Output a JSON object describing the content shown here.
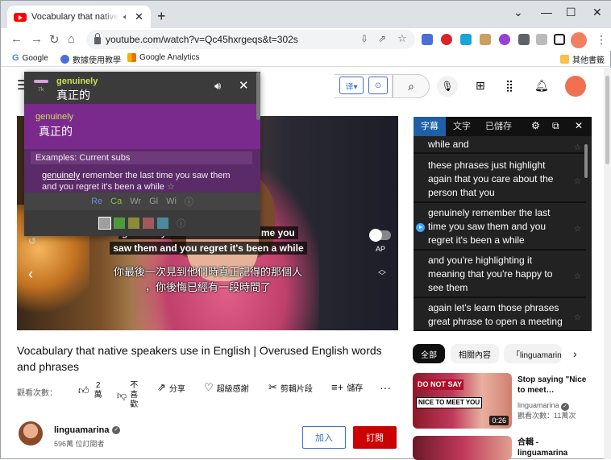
{
  "browser": {
    "tab_title": "Vocabulary that native speakers use in English",
    "url": "youtube.com/watch?v=Qc45hxrgeqs&t=302s",
    "bookmarks": [
      "Google",
      "數據使用教學",
      "Google Analytics"
    ],
    "other_bookmarks": "其他書籤"
  },
  "dictionary": {
    "frequency": "7k",
    "word": "genuinely",
    "translation": "真正的",
    "entry_word": "genuinely",
    "entry_translation": "真正的",
    "examples_header": "Examples: Current subs",
    "example_highlight": "genuinely",
    "example_rest": " remember the last time you saw them and you regret it's been a while",
    "sources": [
      "Re",
      "Ca",
      "Wr",
      "Gl",
      "Wi"
    ],
    "info_icon": "ⓘ",
    "swatches": [
      "#9e9e9e",
      "#4e9a3a",
      "#8a8a3a",
      "#a05a5a",
      "#4a8a9a"
    ]
  },
  "video": {
    "caption_en_1": "gen ..nely remember the last time you",
    "caption_en_2": "saw them and you regret it's been a while",
    "caption_zh_1": "你最後一次見到他們時真正記得的那個人",
    "caption_zh_2": "，你後悔已經有一段時間了",
    "ap_label": "AP"
  },
  "subtitle_panel": {
    "tabs": [
      "字幕",
      "文字",
      "已儲存"
    ],
    "items": [
      "while and",
      "these phrases just highlight again that you care about the person that you",
      "genuinely remember the last time you saw them and you regret it's been a while",
      "and you're highlighting it meaning that you're happy to see them",
      "again let's learn those phrases great phrase to open a meeting with"
    ]
  },
  "video_info": {
    "title": "Vocabulary that native speakers use in English | Overused English words and phrases",
    "views_label": "觀看次數：",
    "likes": "2萬",
    "dislike": "不喜歡",
    "share": "分享",
    "thanks": "超級感謝",
    "clip": "剪輯片段",
    "save": "儲存",
    "more": "···",
    "channel": "linguamarina",
    "subscribers": "596萬 位訂閱者",
    "join": "加入",
    "subscribe": "訂閱"
  },
  "chips": [
    "全部",
    "相關內容",
    "「linguamarina"
  ],
  "recommendations": [
    {
      "title": "Stop saying \"Nice to meet…",
      "channel": "linguamarina",
      "views": "觀看次數：11萬次",
      "duration": "0:26",
      "thumb_text_1": "DO NOT SAY",
      "thumb_text_2": "NICE TO MEET YOU"
    },
    {
      "title": "合輯 - linguamarina"
    }
  ],
  "colors": {
    "dict_purple": "#7a2a8c",
    "subtitle_active_tab": "#1e5fa8",
    "subscribe_red": "#cc0000",
    "lingq_green": "#c6e05a"
  }
}
